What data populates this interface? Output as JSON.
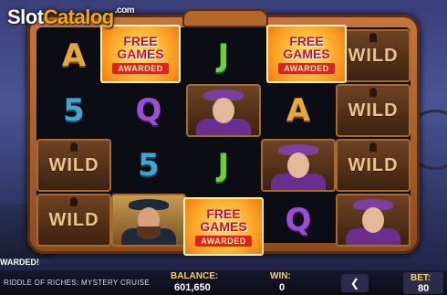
{
  "watermark": {
    "text_main": "Slot",
    "text_accent": "Catalog",
    "suffix": ".com"
  },
  "reels": {
    "cells": [
      {
        "sym": "A"
      },
      {
        "sym": "5"
      },
      {
        "sym": "WILD"
      },
      {
        "sym": "WILD"
      },
      {
        "sym": "FREE"
      },
      {
        "sym": "Q"
      },
      {
        "sym": "5"
      },
      {
        "sym": "CAPTAIN"
      },
      {
        "sym": "J"
      },
      {
        "sym": "LADY"
      },
      {
        "sym": "J"
      },
      {
        "sym": "FREE"
      },
      {
        "sym": "FREE"
      },
      {
        "sym": "A"
      },
      {
        "sym": "LADY"
      },
      {
        "sym": "Q"
      },
      {
        "sym": "WILD"
      },
      {
        "sym": "WILD"
      },
      {
        "sym": "WILD"
      },
      {
        "sym": "LADY"
      }
    ]
  },
  "free_games": {
    "line1": "FREE",
    "line2": "GAMES",
    "badge": "AWARDED"
  },
  "wild_label": "WILD",
  "status_message": "WARDED!",
  "footer": {
    "game_title": "RIDDLE OF RICHES: MYSTERY CRUISE",
    "balance_label": "BALANCE:",
    "balance_value": "601,650",
    "win_label": "WIN:",
    "win_value": "0",
    "bet_label": "BET:",
    "bet_value": "80",
    "prev_bet_icon": "chevron-left-icon"
  }
}
